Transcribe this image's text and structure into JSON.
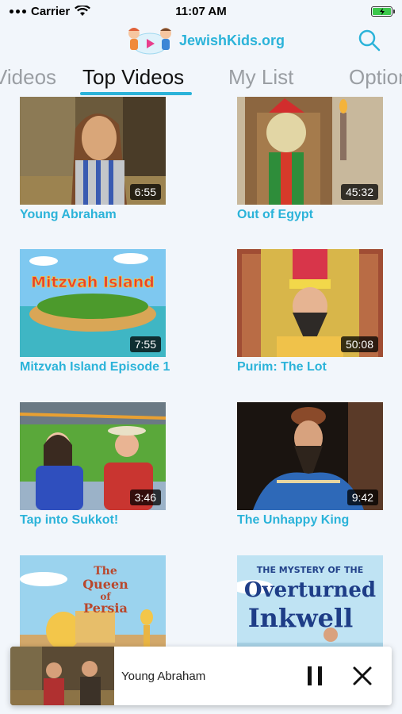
{
  "status_bar": {
    "carrier": "Carrier",
    "time": "11:07 AM"
  },
  "header": {
    "logo_text_1": "Jewish",
    "logo_text_2": "Kids",
    "logo_text_3": ".org",
    "search_icon": "search-icon"
  },
  "tabs": [
    {
      "label": "Videos",
      "active": false
    },
    {
      "label": "Top Videos",
      "active": true
    },
    {
      "label": "My List",
      "active": false
    },
    {
      "label": "Options",
      "active": false
    }
  ],
  "videos": [
    {
      "title": "Young Abraham",
      "duration": "6:55"
    },
    {
      "title": "Out of Egypt",
      "duration": "45:32"
    },
    {
      "title": "Mitzvah Island Episode 1",
      "duration": "7:55",
      "thumb_text": "Mitzvah Island"
    },
    {
      "title": "Purim: The Lot",
      "duration": "50:08"
    },
    {
      "title": "Tap into Sukkot!",
      "duration": "3:46"
    },
    {
      "title": "The Unhappy King",
      "duration": "9:42"
    },
    {
      "title": "",
      "duration": "",
      "thumb_text_1": "The",
      "thumb_text_2": "Queen",
      "thumb_text_3": "of",
      "thumb_text_4": "Persia"
    },
    {
      "title": "",
      "duration": "",
      "thumb_text_1": "THE MYSTERY OF THE",
      "thumb_text_2": "Overturned",
      "thumb_text_3": "Inkwell"
    }
  ],
  "mini_player": {
    "title": "Young Abraham",
    "pause_icon": "pause-icon",
    "close_icon": "close-icon"
  },
  "colors": {
    "accent": "#2bb3d9",
    "background": "#f2f6fb"
  }
}
